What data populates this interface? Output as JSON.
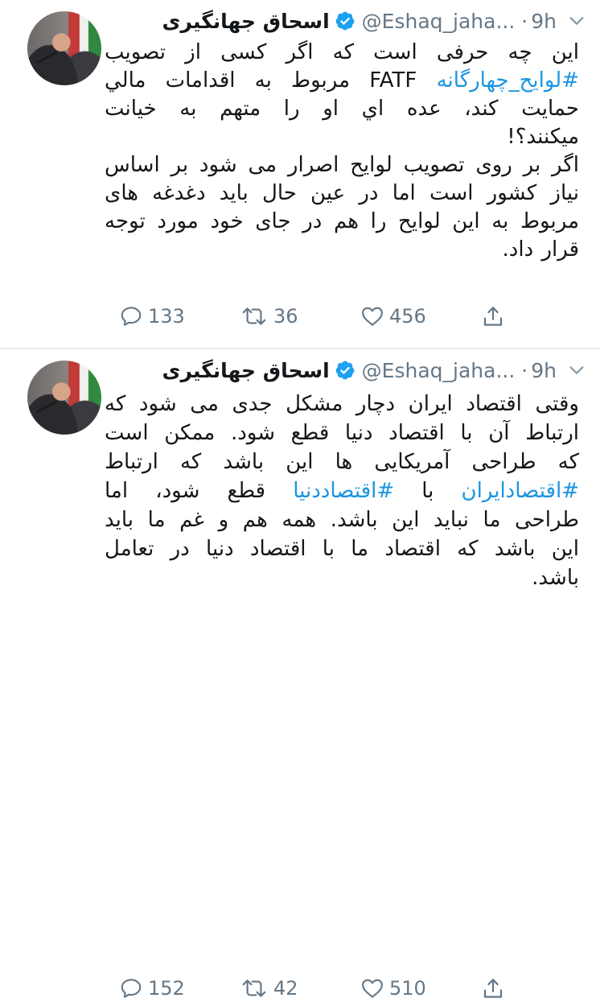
{
  "tweets": [
    {
      "display_name": "اسحاق جهانگیری",
      "handle": "@Eshaq_jaha...",
      "separator": "·",
      "time": "9h",
      "lines": [
        [
          "این چه حرفی است که اگر کسی از تصویب"
        ],
        [
          "#لوایح_چهارگانه",
          " FATF مربوط به اقدامات مالي"
        ],
        [
          "حمایت کند، عده اي او را متهم به خیانت"
        ],
        [
          "میکنند؟!"
        ],
        [
          "اگر بر روی تصویب لوایح اصرار می شود بر اساس"
        ],
        [
          "نیاز کشور است اما در عین حال باید دغدغه های"
        ],
        [
          "مربوط به این لوایح را هم در جای خود مورد توجه"
        ],
        [
          "قرار داد."
        ]
      ],
      "replies": "133",
      "retweets": "36",
      "likes": "456"
    },
    {
      "display_name": "اسحاق جهانگیری",
      "handle": "@Eshaq_jaha...",
      "separator": "·",
      "time": "9h",
      "lines": [
        [
          "وقتی اقتصاد ایران دچار مشکل جدی می شود که"
        ],
        [
          "ارتباط آن با اقتصاد دنیا قطع شود. ممکن است"
        ],
        [
          "که طراحی آمریکایی ها این باشد که ارتباط"
        ],
        [
          "#اقتصادایران",
          " با ",
          "#اقتصاددنیا",
          " قطع شود، اما"
        ],
        [
          "طراحی ما نباید این باشد. همه هم و غم ما باید"
        ],
        [
          "این باشد که اقتصاد ما با اقتصاد دنیا در تعامل"
        ],
        [
          "باشد."
        ]
      ],
      "replies": "152",
      "retweets": "42",
      "likes": "510"
    }
  ],
  "icons": {
    "verified": "verified-badge-icon",
    "caret": "chevron-down-icon",
    "reply": "reply-icon",
    "retweet": "retweet-icon",
    "like": "heart-icon",
    "share": "share-icon"
  },
  "colors": {
    "link": "#1b95e0",
    "verified": "#1da1f2",
    "secondary_text": "#657786"
  }
}
